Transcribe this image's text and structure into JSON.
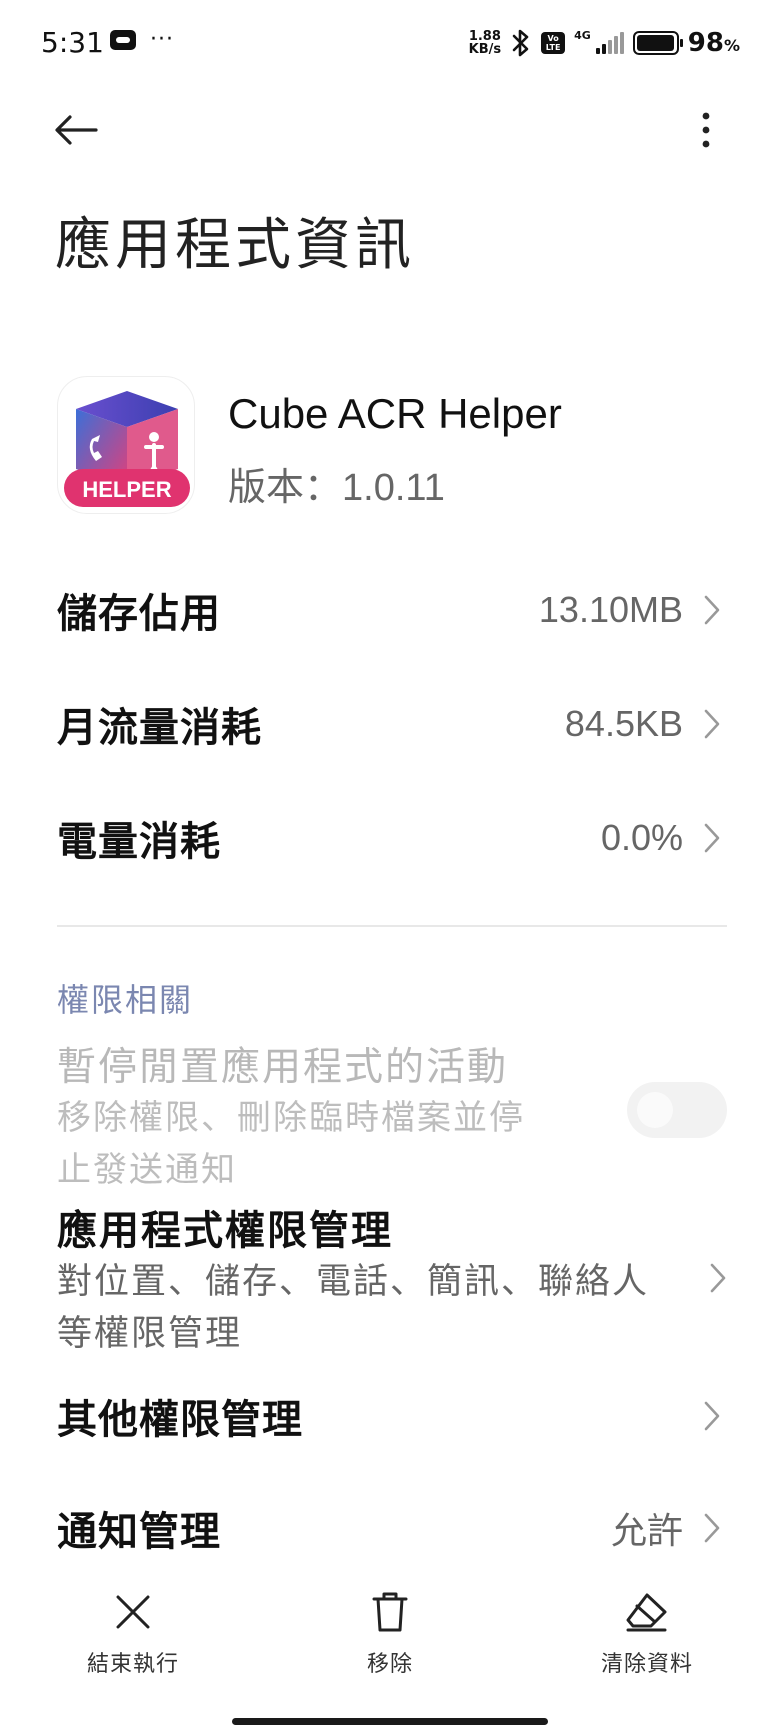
{
  "status_bar": {
    "time": "5:31",
    "net_speed_value": "1.88",
    "net_speed_unit": "KB/s",
    "volte_line1": "Vo",
    "volte_line2": "LTE",
    "network_type": "4G",
    "battery_percent": "98",
    "battery_percent_sign": "%",
    "battery_level": 0.98,
    "icons": [
      "sim-icon",
      "more-dots-icon",
      "bluetooth-icon",
      "volte-icon",
      "signal-icon",
      "battery-icon"
    ]
  },
  "header": {
    "back_icon": "back-arrow-icon",
    "more_icon": "more-vertical-icon",
    "title": "應用程式資訊"
  },
  "app": {
    "name": "Cube ACR Helper",
    "version": "版本：1.0.11",
    "icon_badge_text": "HELPER"
  },
  "usage_rows": [
    {
      "label": "儲存佔用",
      "value": "13.10MB"
    },
    {
      "label": "月流量消耗",
      "value": "84.5KB"
    },
    {
      "label": "電量消耗",
      "value": "0.0%"
    }
  ],
  "permissions": {
    "section_title": "權限相關",
    "pause_title": "暫停閒置應用程式的活動",
    "pause_desc_line1": "移除權限、刪除臨時檔案並停",
    "pause_desc_line2": "止發送通知",
    "pause_enabled": false,
    "manage_title": "應用程式權限管理",
    "manage_desc_line1": "對位置、儲存、電話、簡訊、聯絡人",
    "manage_desc_line2": "等權限管理",
    "other_title": "其他權限管理",
    "notify_title": "通知管理",
    "notify_value": "允許"
  },
  "actions": [
    {
      "label": "結束執行",
      "icon": "close-x-icon"
    },
    {
      "label": "移除",
      "icon": "trash-icon"
    },
    {
      "label": "清除資料",
      "icon": "eraser-icon"
    }
  ],
  "colors": {
    "section_accent": "#7b87b0",
    "icon_gradient_start": "#3b6fd8",
    "icon_gradient_end": "#e0407a",
    "badge_pink": "#e0336f"
  }
}
